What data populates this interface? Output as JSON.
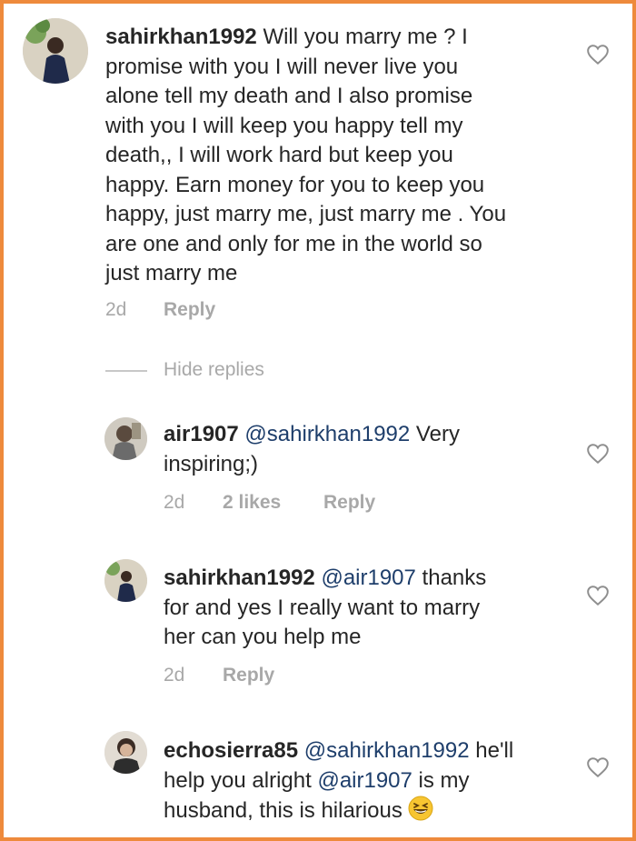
{
  "comments": [
    {
      "username": "sahirkhan1992",
      "lines": [
        " Will you marry me ? I",
        "promise with you I will never live you",
        "alone tell my death and I also promise",
        "with you I will keep you happy tell my",
        "death,, I will work hard but keep you",
        "happy. Earn money for you to keep you",
        "happy, just marry me, just marry me . You",
        "are one and only for me in the world so",
        "just marry me"
      ],
      "time": "2d",
      "reply": "Reply"
    }
  ],
  "hide_replies": "Hide replies",
  "replies": [
    {
      "username": "air1907",
      "mention": "@sahirkhan1992",
      "line1_rest": " Very",
      "line2": "inspiring;)",
      "time": "2d",
      "likes": "2 likes",
      "reply": "Reply"
    },
    {
      "username": "sahirkhan1992",
      "mention": "@air1907",
      "line1_rest": " thanks",
      "line2": "for and yes I really want to marry",
      "line3": "her can you help me",
      "time": "2d",
      "reply": "Reply"
    },
    {
      "username": "echosierra85",
      "mention": "@sahirkhan1992",
      "line1_rest": " he'll",
      "line2_pre": "help you alright ",
      "mention2": "@air1907",
      "line2_post": " is my",
      "line3": "husband, this is hilarious ",
      "emoji": "grinning-squinting-face-icon"
    }
  ],
  "colors": {
    "border": "#ee8a3c",
    "mention": "#1e3e6b",
    "muted": "#a8a8a8",
    "text": "#262626"
  }
}
